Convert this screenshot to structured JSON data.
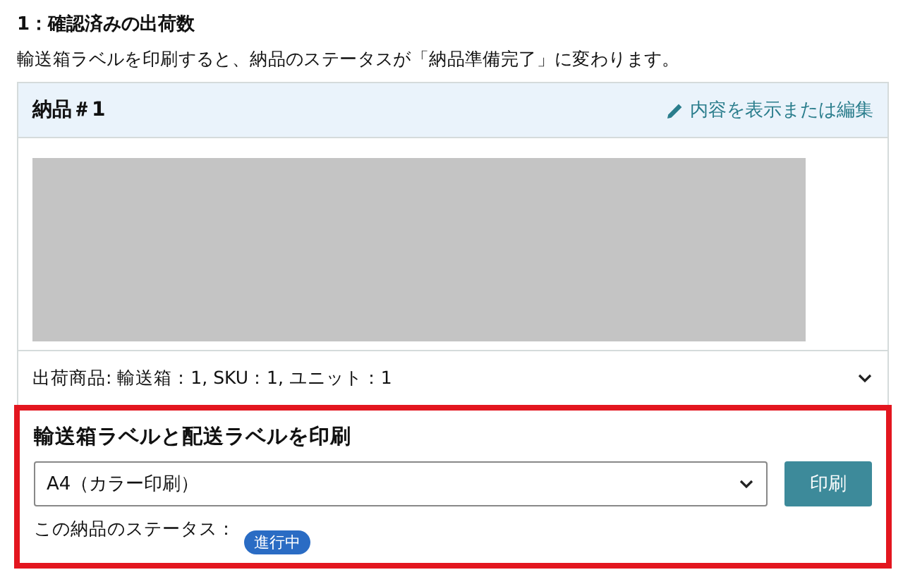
{
  "section_title": "1：確認済みの出荷数",
  "description": "輸送箱ラベルを印刷すると、納品のステータスが「納品準備完了」に変わります。",
  "shipment": {
    "title": "納品＃1",
    "edit_link": "内容を表示または編集",
    "summary": "出荷商品: 輸送箱：1, SKU：1, ユニット：1",
    "expanded": false
  },
  "print_panel": {
    "title": "輸送箱ラベルと配送ラベルを印刷",
    "paper_select": {
      "value": "A4（カラー印刷）"
    },
    "print_button": "印刷",
    "status_label": "この納品のステータス：",
    "status_badge": "進行中"
  }
}
